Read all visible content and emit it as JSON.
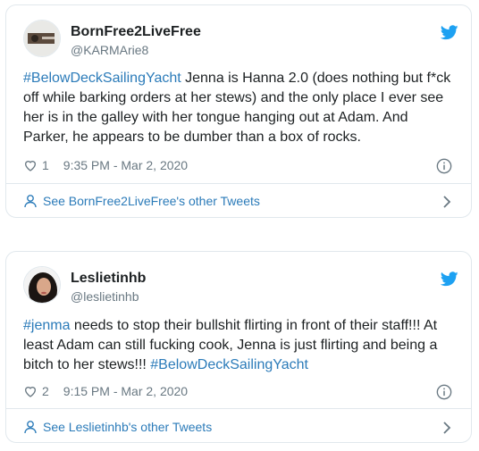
{
  "tweets": [
    {
      "name": "BornFree2LiveFree",
      "handle": "@KARMArie8",
      "text_parts": [
        {
          "text": "#BelowDeckSailingYacht",
          "tag": true
        },
        {
          "text": " Jenna is Hanna 2.0 (does nothing but f*ck off while barking orders at her stews) and the only place I ever see her is in the galley with her tongue hanging out at Adam. And Parker, he appears to be dumber than a box of rocks.",
          "tag": false
        }
      ],
      "likes": "1",
      "timestamp": "9:35 PM - Mar 2, 2020",
      "other_link": "See BornFree2LiveFree's other Tweets"
    },
    {
      "name": "Leslietinhb",
      "handle": "@leslietinhb",
      "text_parts": [
        {
          "text": "#jenma",
          "tag": true
        },
        {
          "text": " needs to stop their bullshit flirting in front of their staff!!! At least Adam can still fucking cook, Jenna is just flirting and being a bitch to her stews!!! ",
          "tag": false
        },
        {
          "text": "#BelowDeckSailingYacht",
          "tag": true
        }
      ],
      "likes": "2",
      "timestamp": "9:15 PM - Mar 2, 2020",
      "other_link": "See Leslietinhb's other Tweets"
    }
  ],
  "icons": {
    "brand": "twitter-bird-icon",
    "like": "heart-icon",
    "info": "info-icon",
    "profile": "person-icon",
    "more": "chevron-right-icon"
  },
  "colors": {
    "link": "#2b7bb9",
    "bird": "#1da1f2",
    "muted": "#697882",
    "border": "#e1e8ed",
    "text": "#1c2022"
  }
}
